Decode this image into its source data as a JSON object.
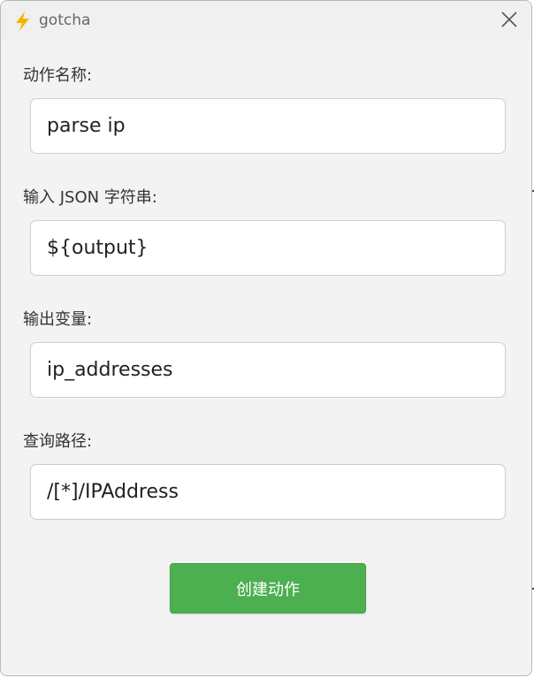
{
  "window": {
    "title": "gotcha"
  },
  "form": {
    "fields": [
      {
        "label": "动作名称:",
        "value": "parse ip"
      },
      {
        "label": "输入 JSON 字符串:",
        "value": "${output}"
      },
      {
        "label": "输出变量:",
        "value": "ip_addresses"
      },
      {
        "label": "查询路径:",
        "value": "/[*]/IPAddress"
      }
    ],
    "submit_label": "创建动作"
  },
  "colors": {
    "accent": "#4caf50",
    "icon": "#f5b400"
  },
  "icons": {
    "app": "lightning-bolt-icon",
    "close": "close-icon"
  }
}
